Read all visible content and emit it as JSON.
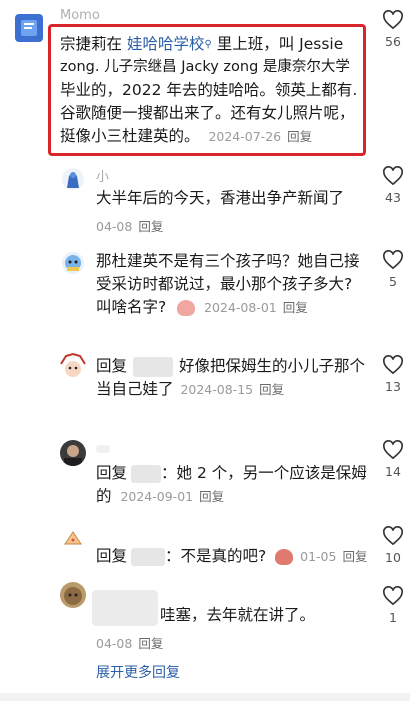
{
  "main_comment": {
    "username": "Momo",
    "text_a": "宗捷莉在 ",
    "link": "娃哈哈学校",
    "text_b": " 里上班，叫 Jessie",
    "line2": "zong. 儿子宗继昌 Jacky zong 是康奈尔大学",
    "line3": "毕业的，2022 年去的娃哈哈。领英上都有.",
    "line4": "谷歌随便一搜都出来了。还有女儿照片呢，",
    "line5": "挺像小三杜建英的。",
    "date": "2024-07-26",
    "reply_label": "回复",
    "likes": "56"
  },
  "replies": [
    {
      "username": "小",
      "text1": "大半年后的今天，香港出争产新闻了",
      "date": "04-08",
      "reply_label": "回复",
      "likes": "43"
    },
    {
      "text1": "那杜建英不是有三个孩子吗？她自己接",
      "text2": "受采访时都说过，最小那个孩子多大?",
      "text3": "叫啥名字?",
      "date": "2024-08-01",
      "reply_label": "回复",
      "likes": "5"
    },
    {
      "prefix": "回复",
      "text1": "好像把保姆生的小儿子那个",
      "text2": "当自己娃了",
      "date": "2024-08-15",
      "reply_label": "回复",
      "likes": "13"
    },
    {
      "prefix": "回复",
      "text1": "：她 2 个，另一个应该是保姆",
      "text2": "的",
      "date": "2024-09-01",
      "reply_label": "回复",
      "likes": "14"
    },
    {
      "prefix": "回复",
      "text1": "：不是真的吧?",
      "date": "01-05",
      "reply_label": "回复",
      "likes": "10"
    },
    {
      "text1": "哇塞，去年就在讲了。",
      "date": "04-08",
      "reply_label": "回复",
      "likes": "1"
    }
  ],
  "expand_more": "展开更多回复",
  "colors": {
    "highlight_border": "#d9252a",
    "link": "#2b5ea8"
  },
  "icons": {
    "like": "heart-outline-icon",
    "user": "user-icon"
  }
}
